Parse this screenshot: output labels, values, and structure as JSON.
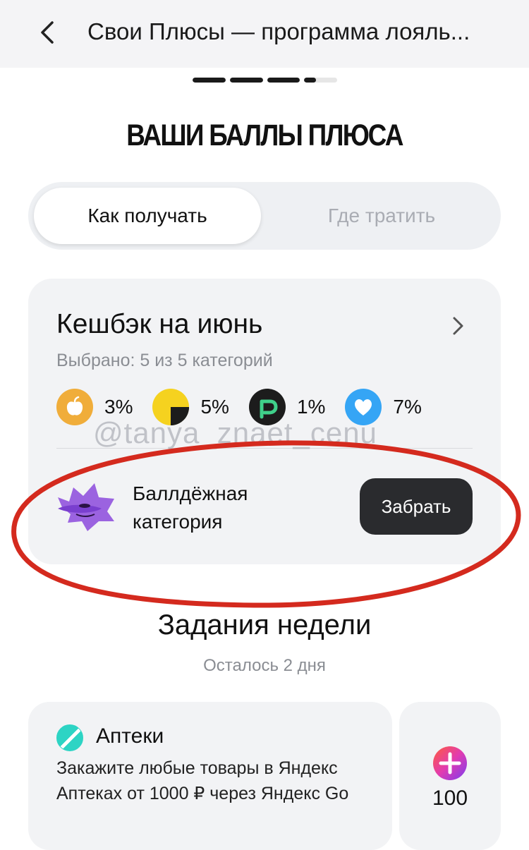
{
  "header": {
    "back_icon": "chevron-left-icon",
    "title": "Свои Плюсы — программа лояль..."
  },
  "stories": {
    "segments_total": 4,
    "progress": [
      1,
      1,
      1,
      0.35
    ]
  },
  "headline": "ВАШИ БАЛЛЫ ПЛЮСА",
  "tabs": [
    {
      "label": "Как получать",
      "active": true
    },
    {
      "label": "Где тратить",
      "active": false
    }
  ],
  "cashback": {
    "title": "Кешбэк на июнь",
    "subtitle": "Выбрано: 5 из 5 категорий",
    "categories": [
      {
        "icon": "apple-icon",
        "percent": "3%",
        "color": "#f0ad3a"
      },
      {
        "icon": "yellow-black-circle-icon",
        "percent": "5%",
        "color": "#f5d21f"
      },
      {
        "icon": "p-logo-icon",
        "percent": "1%",
        "color": "#1c1c1c"
      },
      {
        "icon": "heart-v-icon",
        "percent": "7%",
        "color": "#35a5f5"
      }
    ],
    "watermark": "@tanya_znaet_cenu",
    "promo": {
      "icon": "purple-mascot-icon",
      "text": "Баллдёжная категория",
      "button": "Забрать"
    }
  },
  "weekly": {
    "title": "Задания недели",
    "subtitle": "Осталось 2 дня",
    "task": {
      "icon": "pharmacy-icon",
      "name": "Аптеки",
      "description": "Закажите любые товары в Яндекс Аптеках от 1000 ₽ через Яндекс Go"
    },
    "reward": {
      "icon": "plus-points-icon",
      "value": "100"
    }
  },
  "colors": {
    "accent_dark": "#2a2b2e",
    "annotation_red": "#d42a1e",
    "card_bg": "#f2f3f5"
  }
}
